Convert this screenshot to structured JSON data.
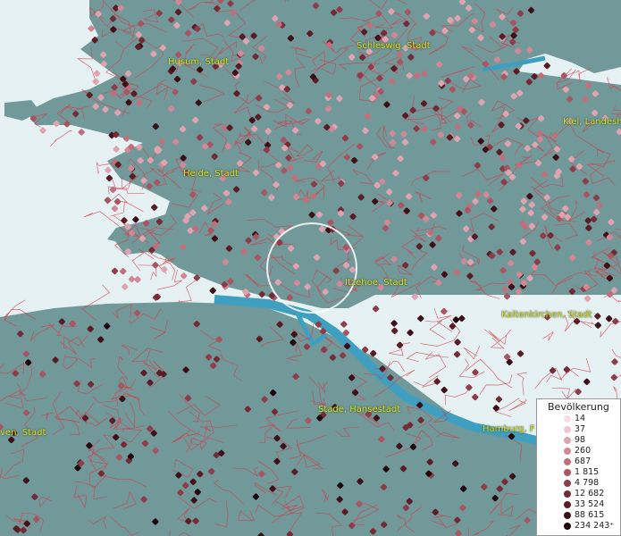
{
  "map": {
    "colors": {
      "water": "#e6f1f4",
      "land": "#71999a",
      "river": "#3f9fc0",
      "boundary": "#d63b46",
      "label": "#e2e21a",
      "focus_ring": "#ffffff"
    },
    "labels": [
      {
        "id": "husum",
        "text": "Husum, Stadt"
      },
      {
        "id": "schleswig",
        "text": "Schleswig, Stadt"
      },
      {
        "id": "kiel",
        "text": "Kiel, Landesh"
      },
      {
        "id": "heide",
        "text": "Heide, Stadt"
      },
      {
        "id": "itzehoe",
        "text": "Itzehoe, Stadt"
      },
      {
        "id": "kaltenkirchen",
        "text": "Kaltenkirchen, Stadt"
      },
      {
        "id": "stade",
        "text": "Stade, Hansestadt"
      },
      {
        "id": "hamburg",
        "text": "Hamburg, F"
      },
      {
        "id": "cuxhaven",
        "text": "ven, Stadt"
      }
    ]
  },
  "legend": {
    "title": "Bevölkerung",
    "entries": [
      {
        "label": "14",
        "color": "#f6dde5"
      },
      {
        "label": "37",
        "color": "#eec6d0"
      },
      {
        "label": "98",
        "color": "#e0a4b0"
      },
      {
        "label": "260",
        "color": "#d28995"
      },
      {
        "label": "687",
        "color": "#c06f7b"
      },
      {
        "label": "1 815",
        "color": "#a85562"
      },
      {
        "label": "4 798",
        "color": "#8d3d49"
      },
      {
        "label": "12 682",
        "color": "#732b36"
      },
      {
        "label": "33 524",
        "color": "#5a1d26"
      },
      {
        "label": "88 615",
        "color": "#3d1018"
      },
      {
        "label": "234 243⁺",
        "color": "#21060b"
      }
    ]
  }
}
